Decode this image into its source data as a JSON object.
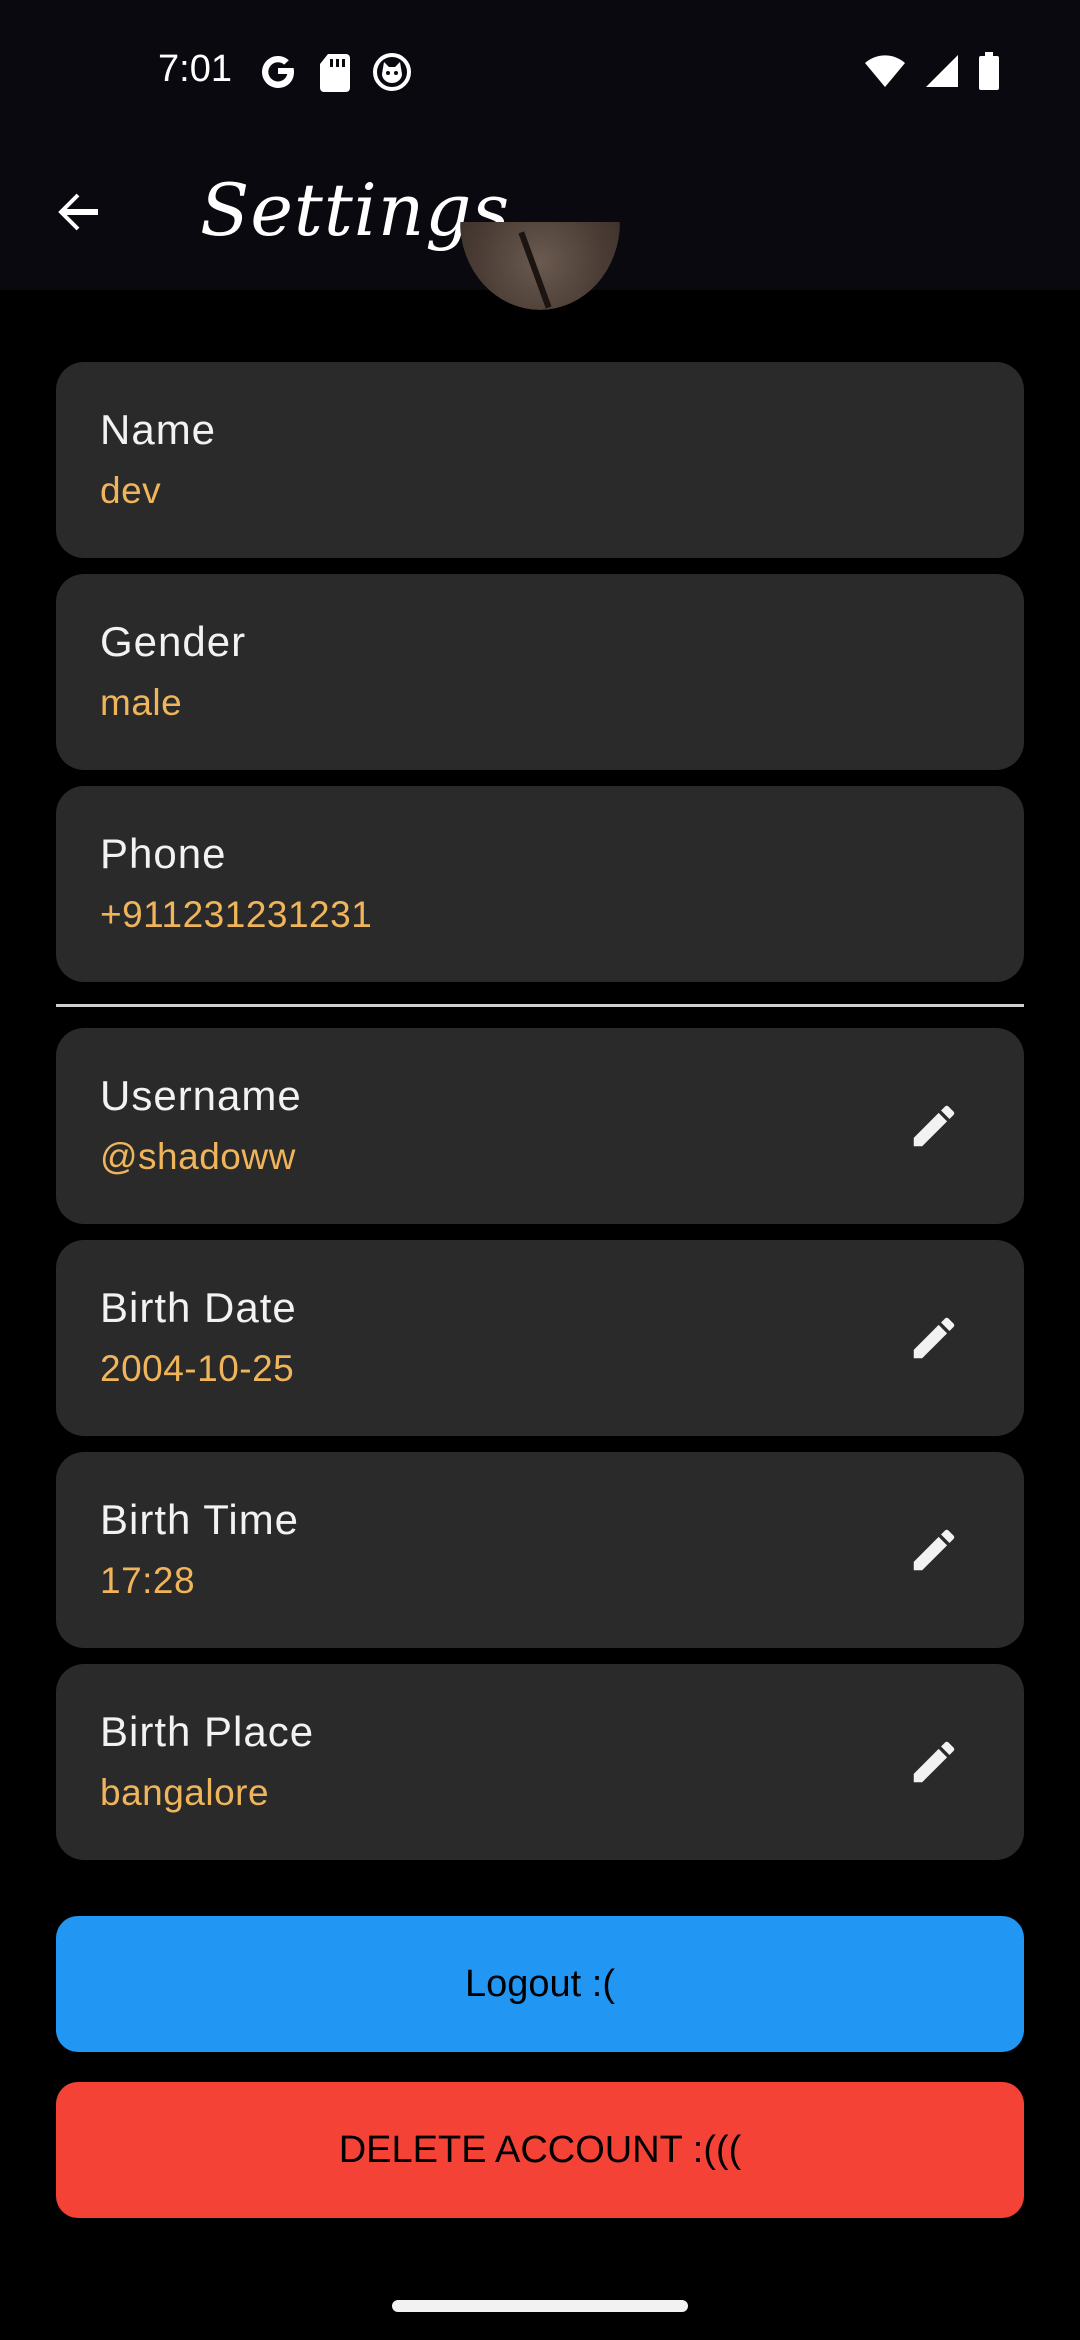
{
  "status_bar": {
    "time": "7:01",
    "left_icons": [
      "google-icon",
      "sd-card-icon",
      "cat-notification-icon"
    ],
    "right_icons": [
      "wifi-icon",
      "signal-icon",
      "battery-icon"
    ]
  },
  "header": {
    "title": "Settings.",
    "back_icon": "arrow-back-icon"
  },
  "profile": {
    "fields": [
      {
        "label": "Name",
        "value": "dev"
      },
      {
        "label": "Gender",
        "value": "male"
      },
      {
        "label": "Phone",
        "value": "+911231231231"
      }
    ],
    "editable_fields": [
      {
        "label": "Username",
        "value": "@shadoww",
        "icon": "pencil-icon"
      },
      {
        "label": "Birth Date",
        "value": "2004-10-25",
        "icon": "pencil-icon"
      },
      {
        "label": "Birth Time",
        "value": "17:28",
        "icon": "pencil-icon"
      },
      {
        "label": "Birth Place",
        "value": "bangalore",
        "icon": "pencil-icon"
      }
    ]
  },
  "actions": {
    "logout_label": "Logout :(",
    "delete_label": "DELETE ACCOUNT :((("
  },
  "colors": {
    "background": "#000000",
    "bar": "#0a0910",
    "card": "#2a2a2a",
    "value": "#f0b55a",
    "logout": "#2196f3",
    "delete": "#f44336"
  }
}
